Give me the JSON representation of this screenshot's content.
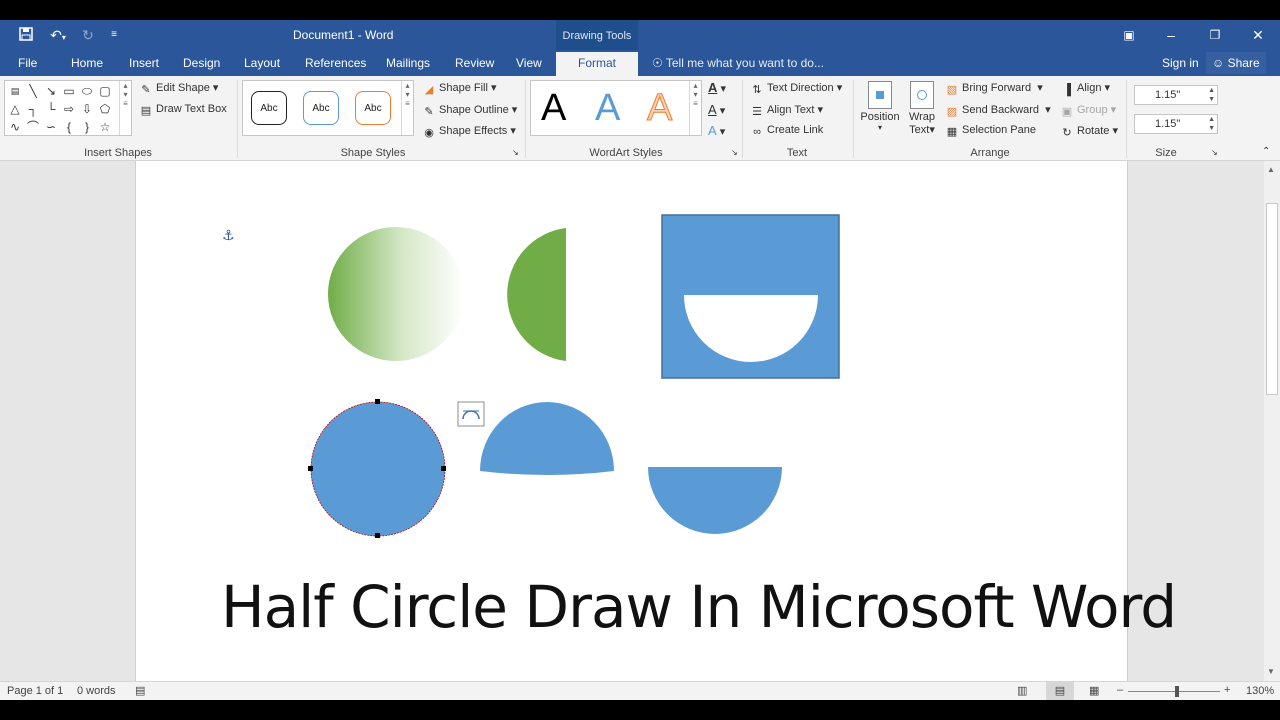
{
  "titlebar": {
    "doc_title": "Document1 - Word",
    "context_tab": "Drawing Tools",
    "quick_access": [
      "save-icon",
      "undo-icon",
      "redo-icon",
      "customize-icon"
    ],
    "window_buttons": [
      "ribbon-display-icon",
      "minimize-icon",
      "restore-icon",
      "close-icon"
    ]
  },
  "tabs": [
    "File",
    "Home",
    "Insert",
    "Design",
    "Layout",
    "References",
    "Mailings",
    "Review",
    "View",
    "Format"
  ],
  "active_tab": "Format",
  "tellme": "Tell me what you want to do...",
  "signin": "Sign in",
  "share": "Share",
  "ribbon": {
    "insert_shapes": {
      "label": "Insert Shapes",
      "edit_shape": "Edit Shape",
      "draw_text_box": "Draw Text Box"
    },
    "shape_styles": {
      "label": "Shape Styles",
      "sample": "Abc",
      "fill": "Shape Fill",
      "outline": "Shape Outline",
      "effects": "Shape Effects"
    },
    "wordart_styles": {
      "label": "WordArt Styles",
      "letter": "A"
    },
    "text": {
      "label": "Text",
      "direction": "Text Direction",
      "align": "Align Text",
      "link": "Create Link"
    },
    "arrange": {
      "label": "Arrange",
      "position": "Position",
      "wrap1": "Wrap",
      "wrap2": "Text",
      "bring_forward": "Bring Forward",
      "send_backward": "Send Backward",
      "selection_pane": "Selection Pane",
      "align": "Align",
      "group": "Group",
      "rotate": "Rotate"
    },
    "size": {
      "label": "Size",
      "height": "1.15\"",
      "width": "1.15\""
    }
  },
  "document": {
    "heading": "Half Circle Draw In Microsoft Word",
    "colors": {
      "blue": "#5b9bd5",
      "green": "#70ad47",
      "outline": "#41719c"
    }
  },
  "status": {
    "page": "Page 1 of 1",
    "words": "0 words",
    "zoom": "130%"
  }
}
